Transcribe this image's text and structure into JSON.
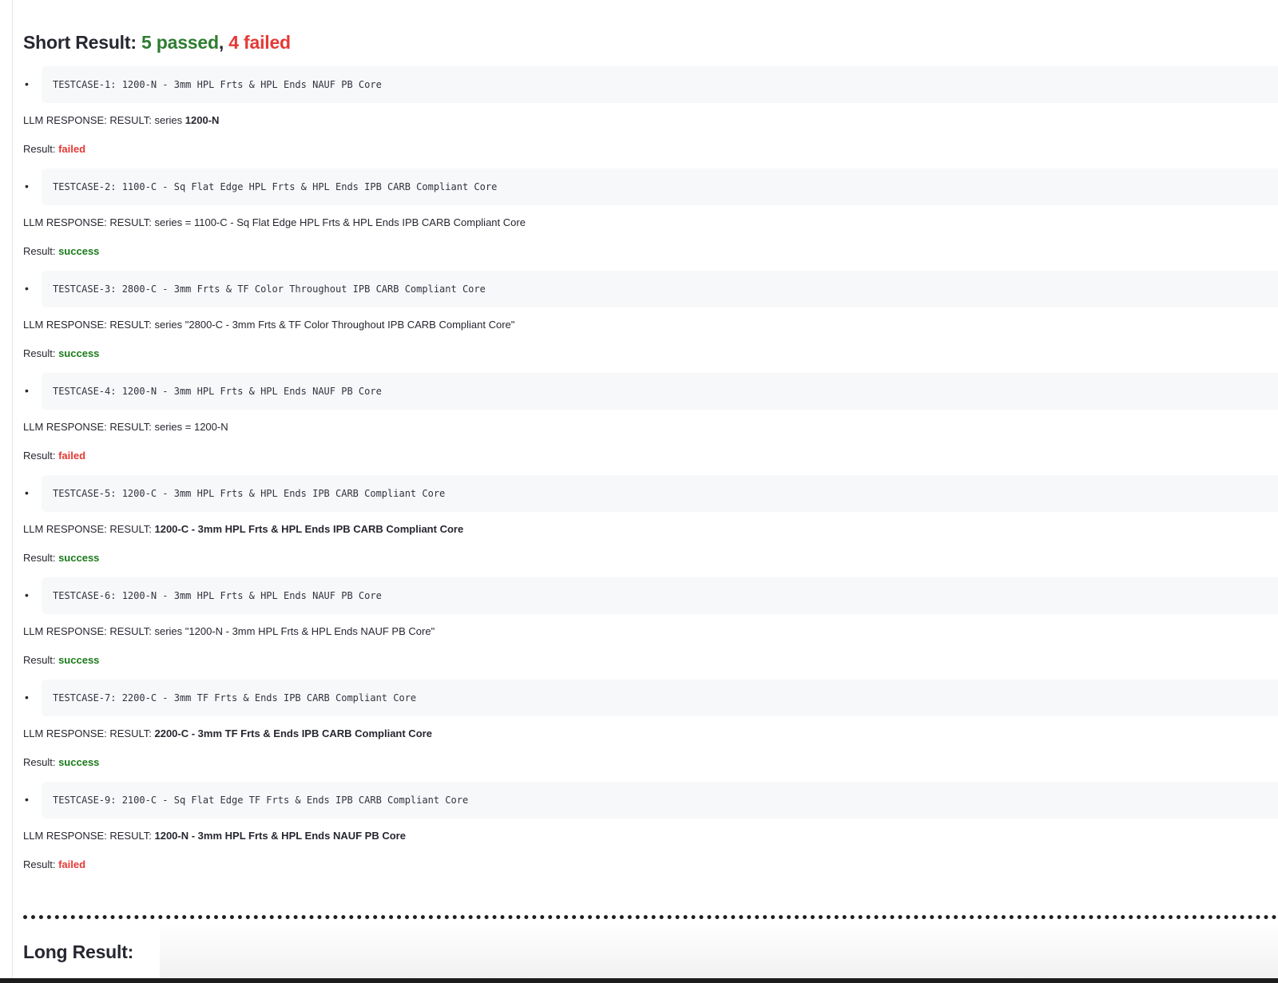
{
  "summary": {
    "prefix": "Short Result: ",
    "passed": "5 passed",
    "separator": ", ",
    "failed": "4 failed"
  },
  "labels": {
    "llm_prefix": "LLM RESPONSE: RESULT: ",
    "result_prefix": "Result: "
  },
  "testcases": [
    {
      "code": "TESTCASE-1: 1200-N - 3mm HPL Frts & HPL Ends NAUF PB Core",
      "llm_plain": "series ",
      "llm_bold": "1200-N",
      "status": "failed"
    },
    {
      "code": "TESTCASE-2: 1100-C - Sq Flat Edge HPL Frts & HPL Ends IPB CARB Compliant Core",
      "llm_plain": "series = 1100-C - Sq Flat Edge HPL Frts & HPL Ends IPB CARB Compliant Core",
      "llm_bold": "",
      "status": "success"
    },
    {
      "code": "TESTCASE-3: 2800-C - 3mm Frts & TF Color Throughout IPB CARB Compliant Core",
      "llm_plain": "series \"2800-C - 3mm Frts & TF Color Throughout IPB CARB Compliant Core\"",
      "llm_bold": "",
      "status": "success"
    },
    {
      "code": "TESTCASE-4: 1200-N - 3mm HPL Frts & HPL Ends NAUF PB Core",
      "llm_plain": "series = 1200-N",
      "llm_bold": "",
      "status": "failed"
    },
    {
      "code": "TESTCASE-5: 1200-C - 3mm HPL Frts & HPL Ends IPB CARB Compliant Core",
      "llm_plain": "",
      "llm_bold": "1200-C - 3mm HPL Frts & HPL Ends IPB CARB Compliant Core",
      "status": "success"
    },
    {
      "code": "TESTCASE-6: 1200-N - 3mm HPL Frts & HPL Ends NAUF PB Core",
      "llm_plain": "series \"1200-N - 3mm HPL Frts & HPL Ends NAUF PB Core\"",
      "llm_bold": "",
      "status": "success"
    },
    {
      "code": "TESTCASE-7: 2200-C - 3mm TF Frts & Ends IPB CARB Compliant Core",
      "llm_plain": "",
      "llm_bold": "2200-C - 3mm TF Frts & Ends IPB CARB Compliant Core",
      "status": "success"
    },
    {
      "code": "TESTCASE-9: 2100-C - Sq Flat Edge TF Frts & Ends IPB CARB Compliant Core",
      "llm_plain": "",
      "llm_bold": "1200-N - 3mm HPL Frts & HPL Ends NAUF PB Core",
      "status": "failed"
    }
  ],
  "long_result": {
    "title": "Long Result:"
  },
  "colors": {
    "passed": "#2e7d32",
    "failed": "#e53935",
    "success": "#1b7a1b"
  }
}
